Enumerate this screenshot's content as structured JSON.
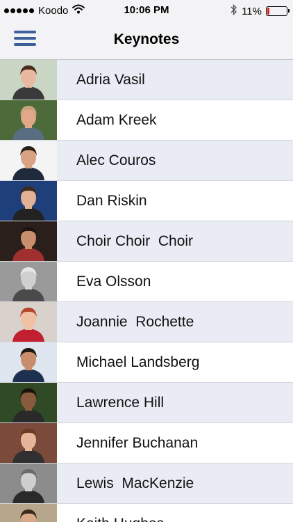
{
  "status_bar": {
    "carrier": "Koodo",
    "time": "10:06 PM",
    "battery_percent": "11%",
    "battery_level": 0.11,
    "icons": [
      "signal-dots-icon",
      "wifi-icon",
      "bluetooth-icon",
      "battery-icon"
    ]
  },
  "nav": {
    "title": "Keynotes",
    "menu_icon": "hamburger-menu-icon"
  },
  "colors": {
    "accent": "#3d5f9c",
    "row_alt": "#e9ecf4",
    "battery_low": "#e02020"
  },
  "speakers": [
    {
      "name": "Adria Vasil",
      "photo": {
        "bg": "#c9d6c4",
        "skin": "#e8b9a0",
        "hair": "#4a2c1c",
        "shirt": "#3a3a3a"
      }
    },
    {
      "name": "Adam Kreek",
      "photo": {
        "bg": "#4d6a3a",
        "skin": "#e0a889",
        "hair": "#c9a27a",
        "shirt": "#5a6e82"
      }
    },
    {
      "name": "Alec Couros",
      "photo": {
        "bg": "#f4f4f4",
        "skin": "#d8a283",
        "hair": "#2b2017",
        "shirt": "#1f2a3c"
      }
    },
    {
      "name": "Dan Riskin",
      "photo": {
        "bg": "#1e3f7a",
        "skin": "#e2b195",
        "hair": "#3b2a1e",
        "shirt": "#222"
      }
    },
    {
      "name": "Choir Choir  Choir",
      "photo": {
        "bg": "#2a1f1a",
        "skin": "#c98e6c",
        "hair": "#1b1410",
        "shirt": "#a03030"
      }
    },
    {
      "name": "Eva Olsson",
      "photo": {
        "bg": "#9a9a9a",
        "skin": "#d0d0d0",
        "hair": "#e8e8e8",
        "shirt": "#4a4a4a"
      }
    },
    {
      "name": "Joannie  Rochette",
      "photo": {
        "bg": "#d9d2cc",
        "skin": "#f0c0a5",
        "hair": "#b5432a",
        "shirt": "#c02030"
      }
    },
    {
      "name": "Michael Landsberg",
      "photo": {
        "bg": "#dfe6ef",
        "skin": "#c98d6b",
        "hair": "#201810",
        "shirt": "#1e3050"
      }
    },
    {
      "name": "Lawrence Hill",
      "photo": {
        "bg": "#2f4a25",
        "skin": "#8a5a3c",
        "hair": "#1a120c",
        "shirt": "#2a2a2a"
      }
    },
    {
      "name": "Jennifer Buchanan",
      "photo": {
        "bg": "#7a4a3a",
        "skin": "#e6b498",
        "hair": "#6a3a22",
        "shirt": "#303030"
      }
    },
    {
      "name": "Lewis  MacKenzie",
      "photo": {
        "bg": "#8c8c8c",
        "skin": "#cfcfcf",
        "hair": "#6a6a6a",
        "shirt": "#2a2a2a"
      }
    },
    {
      "name": "Keith Hughes",
      "photo": {
        "bg": "#b5a68c",
        "skin": "#d9a888",
        "hair": "#3a2a1a",
        "shirt": "#555"
      }
    }
  ]
}
